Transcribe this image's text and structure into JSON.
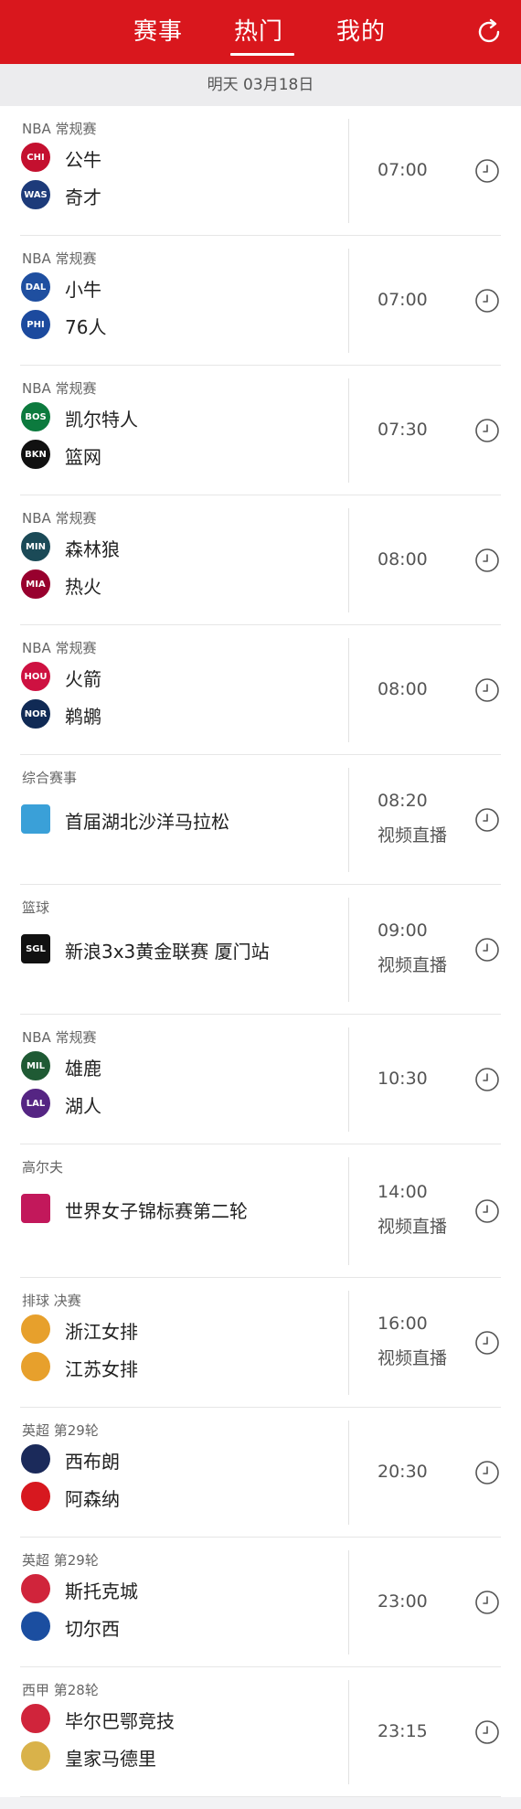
{
  "header": {
    "tabs": [
      "赛事",
      "热门",
      "我的"
    ],
    "active_tab": 1,
    "accent_color": "#d9171d",
    "refresh_icon": "refresh-icon"
  },
  "date_bar": {
    "label": "明天  03月18日"
  },
  "matches": [
    {
      "league": "NBA 常规赛",
      "type": "versus",
      "teams": [
        {
          "name": "公牛",
          "abbr": "CHI",
          "color": "#c4102f"
        },
        {
          "name": "奇才",
          "abbr": "WAS",
          "color": "#1d3b7a"
        }
      ],
      "time": "07:00",
      "live_label": ""
    },
    {
      "league": "NBA 常规赛",
      "type": "versus",
      "teams": [
        {
          "name": "小牛",
          "abbr": "DAL",
          "color": "#1f4fa0"
        },
        {
          "name": "76人",
          "abbr": "PHI",
          "color": "#1c4a9e"
        }
      ],
      "time": "07:00",
      "live_label": ""
    },
    {
      "league": "NBA 常规赛",
      "type": "versus",
      "teams": [
        {
          "name": "凯尔特人",
          "abbr": "BOS",
          "color": "#0c7a3e"
        },
        {
          "name": "篮网",
          "abbr": "BKN",
          "color": "#111111"
        }
      ],
      "time": "07:30",
      "live_label": ""
    },
    {
      "league": "NBA 常规赛",
      "type": "versus",
      "teams": [
        {
          "name": "森林狼",
          "abbr": "MIN",
          "color": "#1b4a57"
        },
        {
          "name": "热火",
          "abbr": "MIA",
          "color": "#98002e"
        }
      ],
      "time": "08:00",
      "live_label": ""
    },
    {
      "league": "NBA 常规赛",
      "type": "versus",
      "teams": [
        {
          "name": "火箭",
          "abbr": "HOU",
          "color": "#ce1141"
        },
        {
          "name": "鹈鹕",
          "abbr": "NOR",
          "color": "#102a55"
        }
      ],
      "time": "08:00",
      "live_label": ""
    },
    {
      "league": "综合赛事",
      "type": "event",
      "teams": [
        {
          "name": "首届湖北沙洋马拉松",
          "abbr": "",
          "color": "#3aa0d8"
        }
      ],
      "time": "08:20",
      "live_label": "视频直播"
    },
    {
      "league": "篮球",
      "type": "event",
      "teams": [
        {
          "name": "新浪3x3黄金联赛 厦门站",
          "abbr": "SGL",
          "color": "#111111"
        }
      ],
      "time": "09:00",
      "live_label": "视频直播"
    },
    {
      "league": "NBA 常规赛",
      "type": "versus",
      "teams": [
        {
          "name": "雄鹿",
          "abbr": "MIL",
          "color": "#1f5a34"
        },
        {
          "name": "湖人",
          "abbr": "LAL",
          "color": "#552583"
        }
      ],
      "time": "10:30",
      "live_label": ""
    },
    {
      "league": "高尔夫",
      "type": "event",
      "teams": [
        {
          "name": "世界女子锦标赛第二轮",
          "abbr": "",
          "color": "#c2185b"
        }
      ],
      "time": "14:00",
      "live_label": "视频直播"
    },
    {
      "league": "排球 决赛",
      "type": "versus",
      "teams": [
        {
          "name": "浙江女排",
          "abbr": "",
          "color": "#e7a02c"
        },
        {
          "name": "江苏女排",
          "abbr": "",
          "color": "#e7a02c"
        }
      ],
      "time": "16:00",
      "live_label": "视频直播"
    },
    {
      "league": "英超 第29轮",
      "type": "versus",
      "teams": [
        {
          "name": "西布朗",
          "abbr": "",
          "color": "#1b2a5a"
        },
        {
          "name": "阿森纳",
          "abbr": "",
          "color": "#d7181f"
        }
      ],
      "time": "20:30",
      "live_label": ""
    },
    {
      "league": "英超 第29轮",
      "type": "versus",
      "teams": [
        {
          "name": "斯托克城",
          "abbr": "",
          "color": "#d0243b"
        },
        {
          "name": "切尔西",
          "abbr": "",
          "color": "#1b4ea0"
        }
      ],
      "time": "23:00",
      "live_label": ""
    },
    {
      "league": "西甲 第28轮",
      "type": "versus",
      "teams": [
        {
          "name": "毕尔巴鄂竞技",
          "abbr": "",
          "color": "#d0243b"
        },
        {
          "name": "皇家马德里",
          "abbr": "",
          "color": "#d9b24a"
        }
      ],
      "time": "23:15",
      "live_label": ""
    }
  ]
}
